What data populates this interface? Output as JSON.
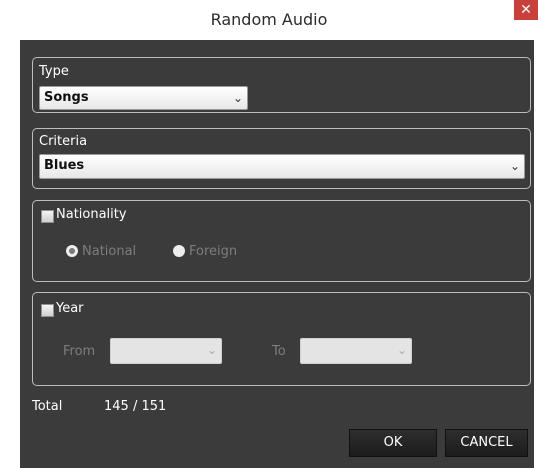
{
  "window": {
    "title": "Random Audio",
    "close_glyph": "✕"
  },
  "type_group": {
    "label": "Type",
    "value": "Songs"
  },
  "criteria_group": {
    "label": "Criteria",
    "value": "Blues"
  },
  "nationality_group": {
    "label": "Nationality",
    "checked": false,
    "options": [
      {
        "label": "National",
        "selected": true
      },
      {
        "label": "Foreign",
        "selected": false
      }
    ]
  },
  "year_group": {
    "label": "Year",
    "checked": false,
    "from_label": "From",
    "from_value": "",
    "to_label": "To",
    "to_value": ""
  },
  "summary": {
    "label": "Total",
    "value": "145 / 151"
  },
  "buttons": {
    "ok": "OK",
    "cancel": "CANCEL"
  },
  "colors": {
    "dialog_bg": "#3b3b3b",
    "close_bg": "#c9403a",
    "button_bg": "#1c1c1c"
  },
  "icons": {
    "close": "close-icon",
    "caret": "chevron-down-icon"
  }
}
